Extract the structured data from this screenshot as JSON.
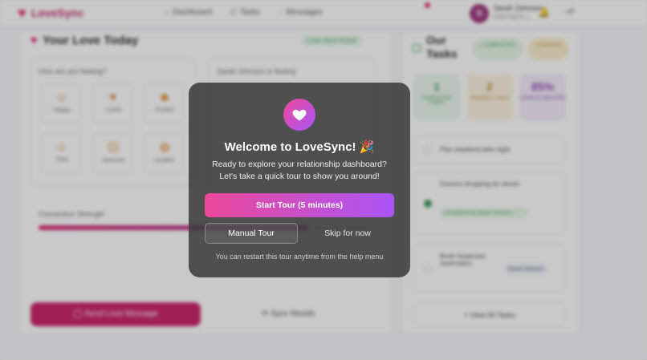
{
  "app": {
    "name": "LoveSync",
    "colors": {
      "brand": "#e3206f",
      "accent_gradient_start": "#ec4899",
      "accent_gradient_end": "#a855f7"
    }
  },
  "nav": {
    "items": [
      {
        "label": "Dashboard",
        "icon": "home-icon"
      },
      {
        "label": "Tasks",
        "icon": "checklist-icon"
      },
      {
        "label": "Messages",
        "icon": "chat-icon"
      }
    ]
  },
  "user": {
    "initial": "S",
    "name": "Sarah Johnson",
    "role": "PARTNER 1"
  },
  "love_today": {
    "title": "Your Love Today",
    "sync_status": "Love Sync Active",
    "feeling_question": "How are you feeling?",
    "partner_feeling": "Sarah Johnson is feeling",
    "moods": [
      "Happy",
      "Loved",
      "Excited",
      "Tired",
      "Stressed",
      "Grateful"
    ],
    "connection_label": "Connection Strength",
    "connection_value": 0.82,
    "send_button": "Send Love Message",
    "sync_moods_button": "Sync Moods"
  },
  "tasks": {
    "title_line1": "Our",
    "title_line2": "Tasks",
    "completed_pill": "1 COMPLETED",
    "pending_pill": "2 PENDING",
    "stats": [
      {
        "value": "1",
        "label": "COMPLETED TODAY"
      },
      {
        "value": "2",
        "label": "PENDING TASKS"
      },
      {
        "value": "85%",
        "label": "COMPLETION RATE"
      }
    ],
    "items": [
      {
        "text": "Plan weekend date night",
        "tag": ""
      },
      {
        "text": "Grocery shopping for dinner",
        "tag": "Completed by Sarah Johnson"
      },
      {
        "text": "Book restaurant reservation",
        "tag": "Sarah Johnson"
      }
    ],
    "view_all": "View All Tasks"
  },
  "modal": {
    "title": "Welcome to LoveSync! 🎉",
    "subtitle_line1": "Ready to explore your relationship dashboard?",
    "subtitle_line2": "Let's take a quick tour to show you around!",
    "start_button": "Start Tour (5 minutes)",
    "manual_button": "Manual Tour",
    "skip_button": "Skip for now",
    "note": "You can restart this tour anytime from the help menu"
  }
}
